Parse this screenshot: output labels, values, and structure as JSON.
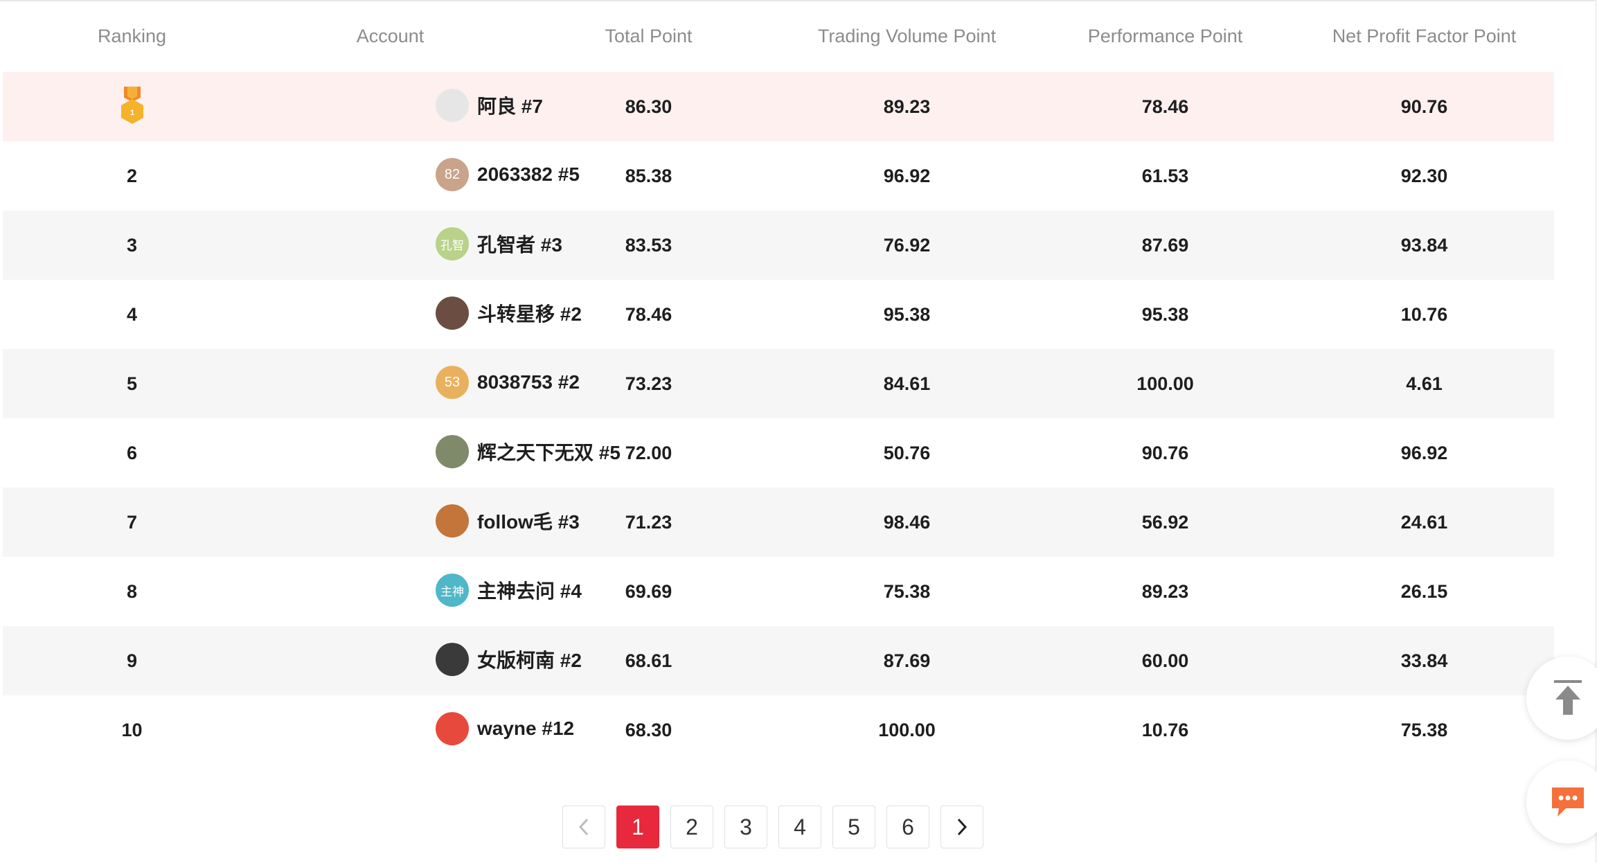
{
  "columns": [
    "Ranking",
    "Account",
    "Total Point",
    "Trading Volume Point",
    "Performance Point",
    "Net Profit Factor Point"
  ],
  "rows": [
    {
      "rank": "",
      "medal": "1",
      "avatar_text": "",
      "avatar_color": "#e6e6e6",
      "account": "阿良 #7",
      "total": "86.30",
      "volume": "89.23",
      "performance": "78.46",
      "npf": "90.76"
    },
    {
      "rank": "2",
      "avatar_text": "82",
      "avatar_color": "#c9a48a",
      "account": "2063382 #5",
      "total": "85.38",
      "volume": "96.92",
      "performance": "61.53",
      "npf": "92.30"
    },
    {
      "rank": "3",
      "avatar_text": "孔智",
      "avatar_color": "#b9d28a",
      "account": "孔智者 #3",
      "total": "83.53",
      "volume": "76.92",
      "performance": "87.69",
      "npf": "93.84"
    },
    {
      "rank": "4",
      "avatar_text": "",
      "avatar_color": "#6b4d42",
      "account": "斗转星移 #2",
      "total": "78.46",
      "volume": "95.38",
      "performance": "95.38",
      "npf": "10.76"
    },
    {
      "rank": "5",
      "avatar_text": "53",
      "avatar_color": "#e9b15d",
      "account": "8038753 #2",
      "total": "73.23",
      "volume": "84.61",
      "performance": "100.00",
      "npf": "4.61"
    },
    {
      "rank": "6",
      "avatar_text": "",
      "avatar_color": "#7e8a6a",
      "account": "辉之天下无双 #5",
      "total": "72.00",
      "volume": "50.76",
      "performance": "90.76",
      "npf": "96.92"
    },
    {
      "rank": "7",
      "avatar_text": "",
      "avatar_color": "#c4763a",
      "account": "follow毛 #3",
      "total": "71.23",
      "volume": "98.46",
      "performance": "56.92",
      "npf": "24.61"
    },
    {
      "rank": "8",
      "avatar_text": "主神",
      "avatar_color": "#4fb7c8",
      "account": "主神去问 #4",
      "total": "69.69",
      "volume": "75.38",
      "performance": "89.23",
      "npf": "26.15"
    },
    {
      "rank": "9",
      "avatar_text": "",
      "avatar_color": "#3a3a3a",
      "account": "女版柯南 #2",
      "total": "68.61",
      "volume": "87.69",
      "performance": "60.00",
      "npf": "33.84"
    },
    {
      "rank": "10",
      "avatar_text": "",
      "avatar_color": "#e74a3c",
      "account": "wayne #12",
      "total": "68.30",
      "volume": "100.00",
      "performance": "10.76",
      "npf": "75.38"
    }
  ],
  "pagination": {
    "pages": [
      "1",
      "2",
      "3",
      "4",
      "5",
      "6"
    ],
    "active": "1",
    "prev_icon": "chevron-left-icon",
    "next_icon": "chevron-right-icon"
  },
  "float_buttons": {
    "top_icon": "back-to-top-icon",
    "chat_icon": "chat-bubble-icon"
  },
  "colors": {
    "accent": "#e8283c",
    "first_row_bg": "#fff0f0",
    "stripe_bg": "#f6f6f6",
    "header_text": "#8c8c8c",
    "medal_gold": "#f4b32a",
    "chat_orange": "#f5703a"
  }
}
